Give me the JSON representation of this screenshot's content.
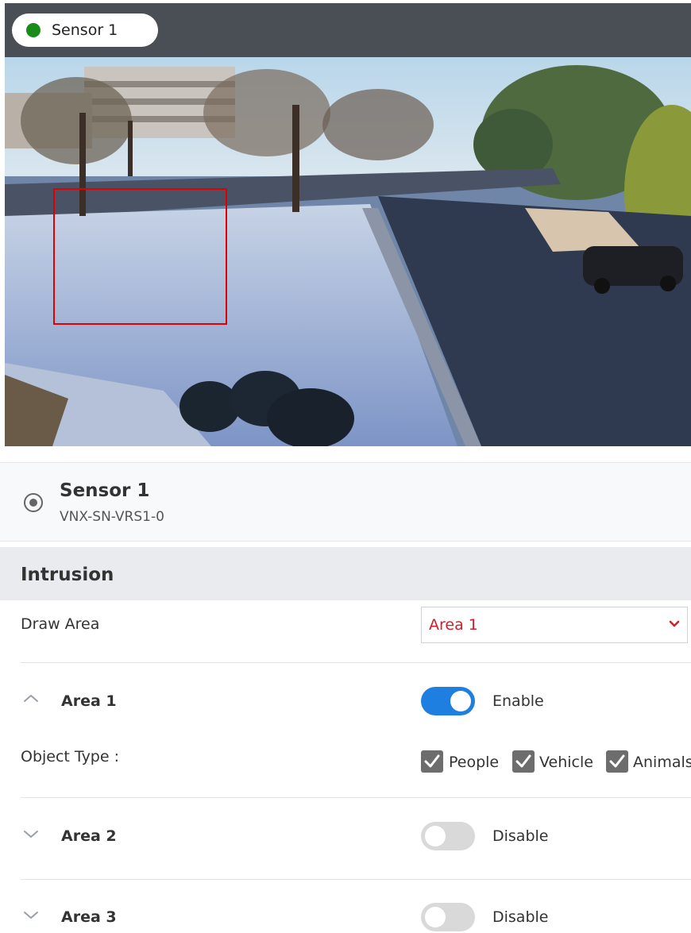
{
  "top_bar": {
    "sensor_pill": {
      "label": "Sensor 1",
      "status_color": "#1a8a1a"
    }
  },
  "camera": {
    "draw_area_color": "#e00000"
  },
  "sensor_info": {
    "name": "Sensor 1",
    "id": "VNX-SN-VRS1-0"
  },
  "intrusion": {
    "title": "Intrusion",
    "draw_area": {
      "label": "Draw Area",
      "selected": "Area 1"
    },
    "areas": [
      {
        "label": "Area 1",
        "expanded": true,
        "enabled": true,
        "status": "Enable"
      },
      {
        "label": "Area 2",
        "expanded": false,
        "enabled": false,
        "status": "Disable"
      },
      {
        "label": "Area 3",
        "expanded": false,
        "enabled": false,
        "status": "Disable"
      }
    ],
    "object_type": {
      "label": "Object Type :",
      "options": [
        {
          "label": "People",
          "checked": true
        },
        {
          "label": "Vehicle",
          "checked": true
        },
        {
          "label": "Animals",
          "checked": true
        }
      ]
    }
  },
  "colors": {
    "accent": "#1e7fe0",
    "selected_text": "#d0202c",
    "header_bg": "#4a4f55"
  }
}
